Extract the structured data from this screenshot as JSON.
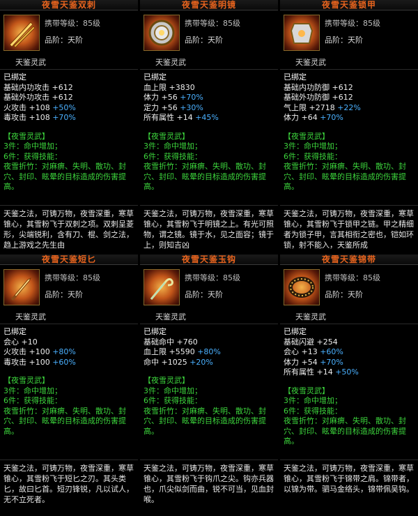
{
  "cards": [
    {
      "title": "夜雪天鉴双刺",
      "icon": "dual-daggers-icon",
      "level_label": "携带等级：",
      "level_value": "85级",
      "grade_label": "品阶：",
      "grade_value": "天阶",
      "set_title": "天鉴灵武",
      "bound": "已绑定",
      "attrs": [
        {
          "name": "基础内功攻击",
          "val": "+612",
          "pct": ""
        },
        {
          "name": "基础外功攻击",
          "val": "+612",
          "pct": ""
        },
        {
          "name": "火攻击",
          "val": "+108",
          "pct": "+50%"
        },
        {
          "name": "毒攻击",
          "val": "+108",
          "pct": "+70%"
        }
      ],
      "set_name": "【夜雪灵武】",
      "set_3": "3件：命中增加；",
      "set_6": "6件：获得技能：",
      "skill": "夜雪折竹：对麻痹、失明、散功、封穴、封印、眩晕的目标造成的伤害提高。",
      "lore": "天鉴之法，可铸万物，夜雪深重，寒草锥心，其雪粉飞于双刺之项。双刺呈菱形，尖端锐利，含有刀、棍、剑之法，趋上游戏之先生由"
    },
    {
      "title": "夜雪天鉴明镜",
      "icon": "mirror-icon",
      "level_label": "携带等级：",
      "level_value": "85级",
      "grade_label": "品阶：",
      "grade_value": "天阶",
      "set_title": "天鉴灵武",
      "bound": "已绑定",
      "attrs": [
        {
          "name": "血上限",
          "val": "+3830",
          "pct": ""
        },
        {
          "name": "体力",
          "val": "+56",
          "pct": "+70%"
        },
        {
          "name": "定力",
          "val": "+56",
          "pct": "+30%"
        },
        {
          "name": "所有属性",
          "val": "+14",
          "pct": "+45%"
        }
      ],
      "set_name": "【夜雪灵武】",
      "set_3": "3件：命中增加；",
      "set_6": "6件：获得技能：",
      "skill": "夜雪折竹：对麻痹、失明、散功、封穴、封印、眩晕的目标造成的伤害提高。",
      "lore": "天鉴之法，可铸万物，夜雪深重，寒草锥心，其雪粉飞于明镜之上。有光可照物，谓之镜。镜于水，见之面容；镜于上，则知吉凶"
    },
    {
      "title": "夜雪天鉴锁甲",
      "icon": "armor-icon",
      "level_label": "携带等级：",
      "level_value": "85级",
      "grade_label": "品阶：",
      "grade_value": "天阶",
      "set_title": "天鉴灵武",
      "bound": "已绑定",
      "attrs": [
        {
          "name": "基础内功防御",
          "val": "+612",
          "pct": ""
        },
        {
          "name": "基础外功防御",
          "val": "+612",
          "pct": ""
        },
        {
          "name": "气上限",
          "val": "+2718",
          "pct": "+22%"
        },
        {
          "name": "体力",
          "val": "+64",
          "pct": "+70%"
        }
      ],
      "set_name": "【夜雪灵武】",
      "set_3": "3件：命中增加；",
      "set_6": "6件：获得技能：",
      "skill": "夜雪折竹：对麻痹、失明、散功、封穴、封印、眩晕的目标造成的伤害提高。",
      "lore": "天鉴之法，可铸万物，夜雪深重，寒草锥心，其雪粉飞于锁甲之链。甲之精细者为锁子甲，言其相衔之密也，铠如环锁，射不能入，天鉴所成"
    },
    {
      "title": "夜雪天鉴短匕",
      "icon": "short-dagger-icon",
      "level_label": "携带等级：",
      "level_value": "85级",
      "grade_label": "品阶：",
      "grade_value": "天阶",
      "set_title": "天鉴灵武",
      "bound": "已绑定",
      "attrs": [
        {
          "name": "会心",
          "val": "+10",
          "pct": ""
        },
        {
          "name": "火攻击",
          "val": "+100",
          "pct": "+80%"
        },
        {
          "name": "毒攻击",
          "val": "+100",
          "pct": "+60%"
        }
      ],
      "set_name": "【夜雪灵武】",
      "set_3": "3件：命中增加；",
      "set_6": "6件：获得技能：",
      "skill": "夜雪折竹：对麻痹、失明、散功、封穴、封印、眩晕的目标造成的伤害提高。",
      "lore": "天鉴之法，可铸万物，夜雪深重，寒草锥心，其雪粉飞于短匕之刃。其头类匕，故曰匕首。短刃锋锐，凡以试人，无不立死者。"
    },
    {
      "title": "夜雪天鉴玉钩",
      "icon": "jade-hook-icon",
      "level_label": "携带等级：",
      "level_value": "85级",
      "grade_label": "品阶：",
      "grade_value": "天阶",
      "set_title": "天鉴灵武",
      "bound": "已绑定",
      "attrs": [
        {
          "name": "基础命中",
          "val": "+760",
          "pct": ""
        },
        {
          "name": "血上限",
          "val": "+5590",
          "pct": "+80%"
        },
        {
          "name": "命中",
          "val": "+1025",
          "pct": "+20%"
        }
      ],
      "set_name": "【夜雪灵武】",
      "set_3": "3件：命中增加；",
      "set_6": "6件：获得技能：",
      "skill": "夜雪折竹：对麻痹、失明、散功、封穴、封印、眩晕的目标造成的伤害提高。",
      "lore": "天鉴之法，可铸万物，夜雪深重，寒草锥心，其雪粉飞于钩爪之尖。钩亦兵器也，爪尖似剑而曲，锐不可当，见血封喉。"
    },
    {
      "title": "夜雪天鉴锦带",
      "icon": "belt-icon",
      "level_label": "携带等级：",
      "level_value": "85级",
      "grade_label": "品阶：",
      "grade_value": "天阶",
      "set_title": "天鉴灵武",
      "bound": "已绑定",
      "attrs": [
        {
          "name": "基础闪避",
          "val": "+254",
          "pct": ""
        },
        {
          "name": "会心",
          "val": "+13",
          "pct": "+60%"
        },
        {
          "name": "体力",
          "val": "+54",
          "pct": "+70%"
        },
        {
          "name": "所有属性",
          "val": "+14",
          "pct": "+50%"
        }
      ],
      "set_name": "【夜雪灵武】",
      "set_3": "3件：命中增加；",
      "set_6": "6件：获得技能：",
      "skill": "夜雪折竹：对麻痹、失明、散功、封穴、封印、眩晕的目标造成的伤害提高。",
      "lore": "天鉴之法，可铸万物，夜雪深重，寒草锥心，其雪粉飞于锦带之肩。锦带者，以锦为带。驷马金络头，锦带佩吴钩。"
    }
  ]
}
